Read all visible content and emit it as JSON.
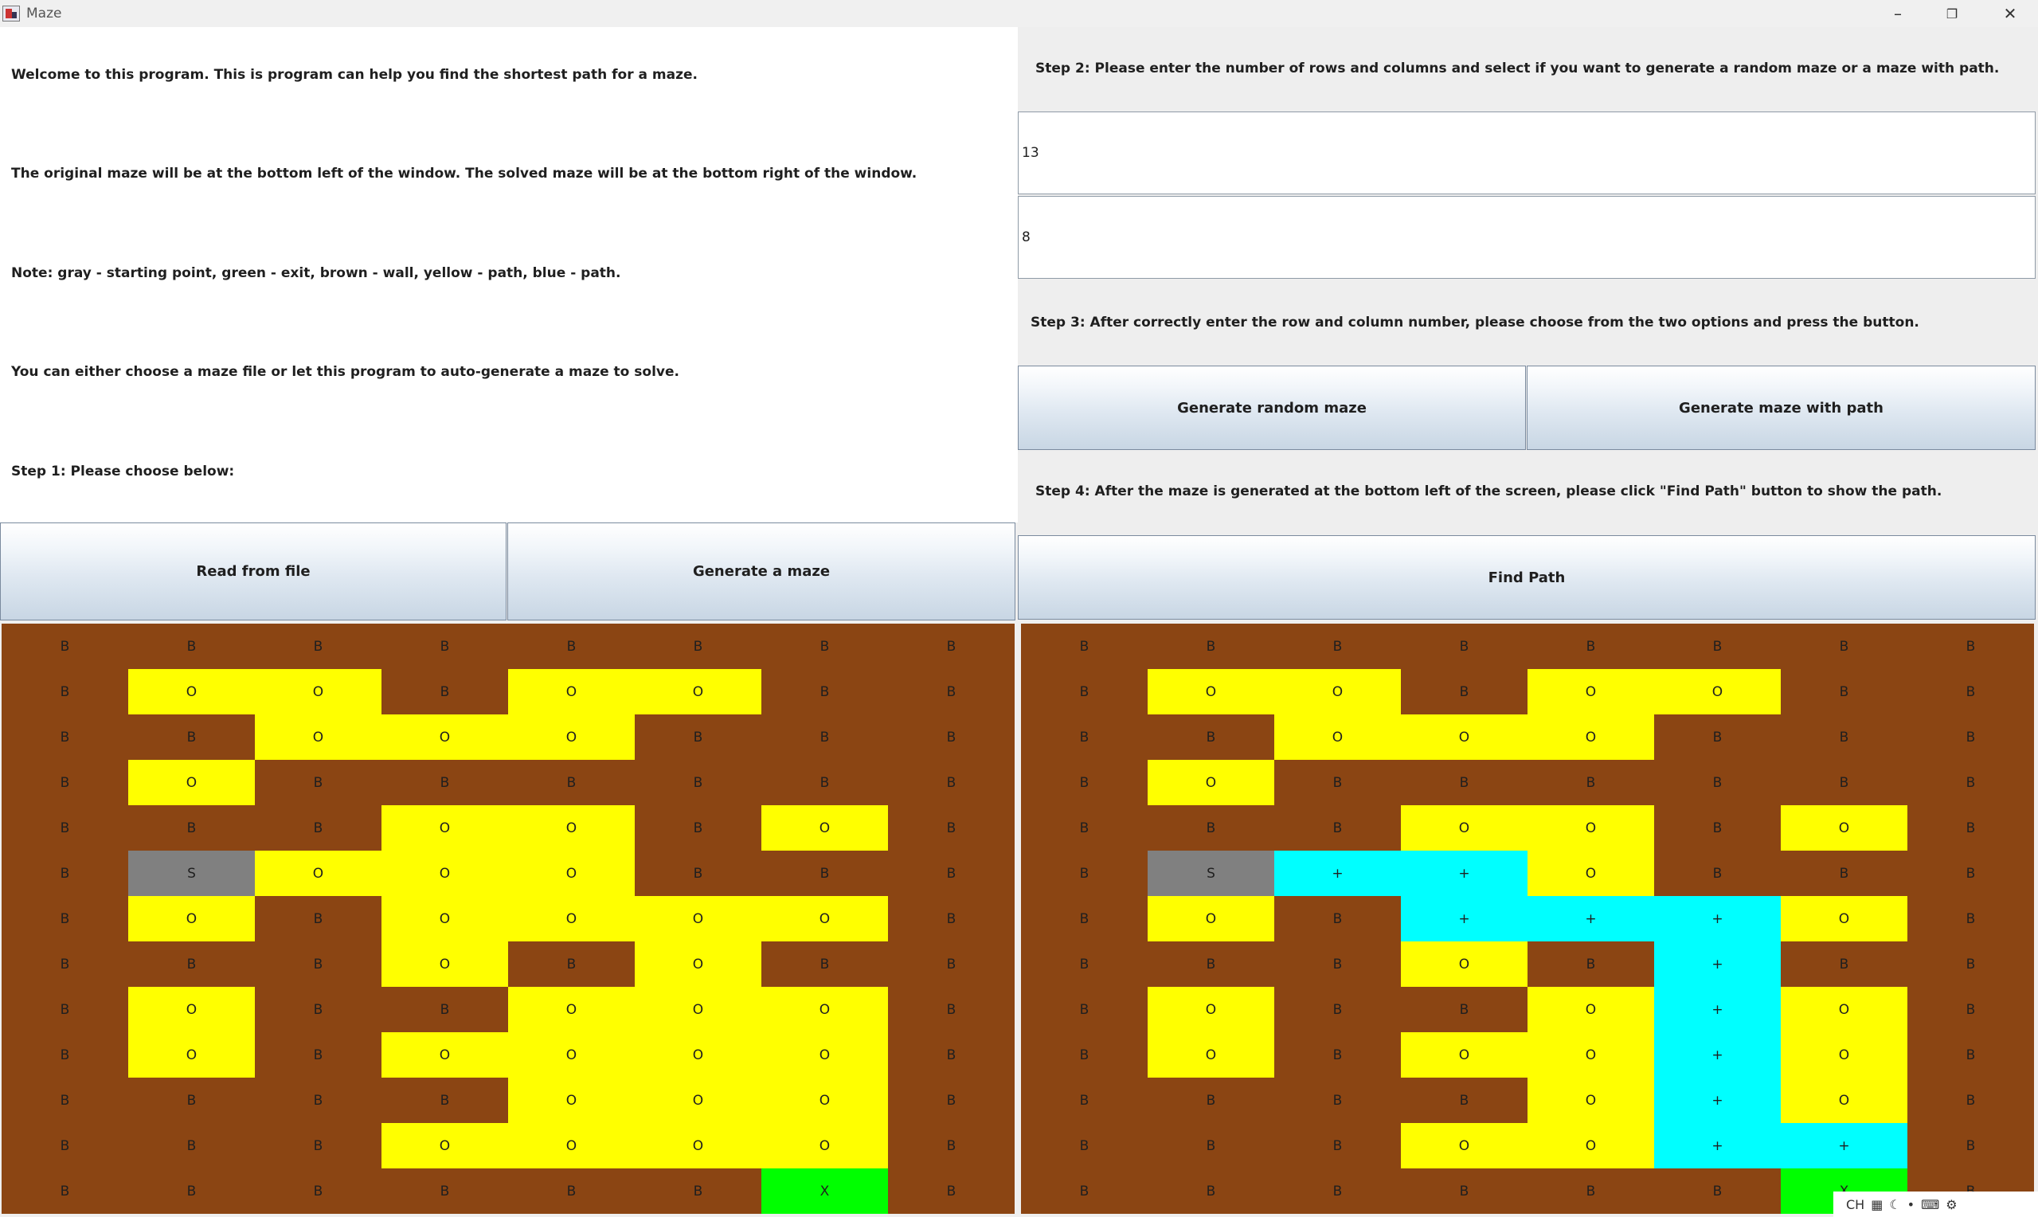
{
  "window": {
    "title": "Maze"
  },
  "left": {
    "texts": [
      "Welcome to this program. This is program can help you find the shortest path for a maze.",
      "The original maze will be at the bottom left of the window. The solved maze will be at the bottom right of the window.",
      "Note: gray - starting point, green - exit, brown - wall, yellow - path, blue - path.",
      "You can either choose a maze file or let this program to auto-generate a maze to solve.",
      "Step 1: Please choose below:"
    ],
    "buttons": {
      "read": "Read from file",
      "generate": "Generate a maze"
    }
  },
  "right": {
    "step2": "Step 2: Please enter the number of rows and columns and select if you want to generate a random maze or a maze with path.",
    "rows_value": "13",
    "cols_value": "8",
    "step3": "Step 3: After correctly enter the row and column number, please choose from the two options and press the button.",
    "btn_random": "Generate random maze",
    "btn_path": "Generate maze with path",
    "step4": "Step 4: After the maze is generated at the bottom left of the screen, please click \"Find Path\" button to show the path.",
    "btn_find": "Find Path"
  },
  "colors": {
    "wall": "#8b4513",
    "open": "#ffff00",
    "start": "#808080",
    "exit": "#00ff00",
    "path": "#00ffff"
  },
  "original_maze": [
    [
      "B",
      "B",
      "B",
      "B",
      "B",
      "B",
      "B",
      "B"
    ],
    [
      "B",
      "O",
      "O",
      "B",
      "O",
      "O",
      "B",
      "B"
    ],
    [
      "B",
      "B",
      "O",
      "O",
      "O",
      "B",
      "B",
      "B"
    ],
    [
      "B",
      "O",
      "B",
      "B",
      "B",
      "B",
      "B",
      "B"
    ],
    [
      "B",
      "B",
      "B",
      "O",
      "O",
      "B",
      "O",
      "B"
    ],
    [
      "B",
      "S",
      "O",
      "O",
      "O",
      "B",
      "B",
      "B"
    ],
    [
      "B",
      "O",
      "B",
      "O",
      "O",
      "O",
      "O",
      "B"
    ],
    [
      "B",
      "B",
      "B",
      "O",
      "B",
      "O",
      "B",
      "B"
    ],
    [
      "B",
      "O",
      "B",
      "B",
      "O",
      "O",
      "O",
      "B"
    ],
    [
      "B",
      "O",
      "B",
      "O",
      "O",
      "O",
      "O",
      "B"
    ],
    [
      "B",
      "B",
      "B",
      "B",
      "O",
      "O",
      "O",
      "B"
    ],
    [
      "B",
      "B",
      "B",
      "O",
      "O",
      "O",
      "O",
      "B"
    ],
    [
      "B",
      "B",
      "B",
      "B",
      "B",
      "B",
      "X",
      "B"
    ]
  ],
  "solved_maze": [
    [
      "B",
      "B",
      "B",
      "B",
      "B",
      "B",
      "B",
      "B"
    ],
    [
      "B",
      "O",
      "O",
      "B",
      "O",
      "O",
      "B",
      "B"
    ],
    [
      "B",
      "B",
      "O",
      "O",
      "O",
      "B",
      "B",
      "B"
    ],
    [
      "B",
      "O",
      "B",
      "B",
      "B",
      "B",
      "B",
      "B"
    ],
    [
      "B",
      "B",
      "B",
      "O",
      "O",
      "B",
      "O",
      "B"
    ],
    [
      "B",
      "S",
      "+",
      "+",
      "O",
      "B",
      "B",
      "B"
    ],
    [
      "B",
      "O",
      "B",
      "+",
      "+",
      "+",
      "O",
      "B"
    ],
    [
      "B",
      "B",
      "B",
      "O",
      "B",
      "+",
      "B",
      "B"
    ],
    [
      "B",
      "O",
      "B",
      "B",
      "O",
      "+",
      "O",
      "B"
    ],
    [
      "B",
      "O",
      "B",
      "O",
      "O",
      "+",
      "O",
      "B"
    ],
    [
      "B",
      "B",
      "B",
      "B",
      "O",
      "+",
      "O",
      "B"
    ],
    [
      "B",
      "B",
      "B",
      "O",
      "O",
      "+",
      "+",
      "B"
    ],
    [
      "B",
      "B",
      "B",
      "B",
      "B",
      "B",
      "X",
      "B"
    ]
  ],
  "tray": {
    "ime": "CH",
    "icons": [
      "grid-icon",
      "moon-icon",
      "dot-icon",
      "keyboard-icon",
      "settings-icon"
    ]
  }
}
